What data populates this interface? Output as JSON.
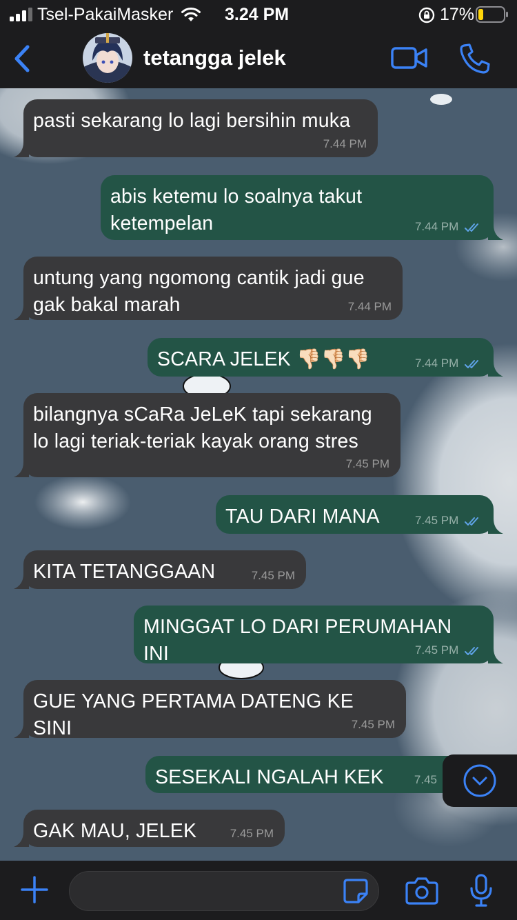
{
  "status_bar": {
    "carrier": "Tsel-PakaiMasker",
    "time": "3.24 PM",
    "battery": "17%",
    "icons": [
      "signal-icon",
      "wifi-icon",
      "orientation-lock-icon",
      "battery-low-icon"
    ]
  },
  "header": {
    "contact_name": "tetangga jelek",
    "icons": [
      "back-chevron-icon",
      "avatar",
      "video-call-icon",
      "phone-call-icon"
    ]
  },
  "messages": [
    {
      "dir": "in",
      "text": "pasti sekarang lo lagi bersihin muka",
      "time": "7.44 PM"
    },
    {
      "dir": "out",
      "text": "abis ketemu lo soalnya takut\nketempelan",
      "time": "7.44 PM",
      "read": true
    },
    {
      "dir": "in",
      "text": "untung yang ngomong cantik jadi gue\ngak bakal marah",
      "time": "7.44 PM"
    },
    {
      "dir": "out",
      "text": "SCARA JELEK 👎🏻👎🏻👎🏻",
      "time": "7.44 PM",
      "read": true
    },
    {
      "dir": "in",
      "text": "bilangnya sCaRa JeLeK tapi sekarang\nlo lagi teriak-teriak kayak orang stres",
      "time": "7.45 PM"
    },
    {
      "dir": "out",
      "text": "TAU DARI MANA",
      "time": "7.45 PM",
      "read": true
    },
    {
      "dir": "in",
      "text": "KITA TETANGGAAN",
      "time": "7.45 PM"
    },
    {
      "dir": "out",
      "text": "MINGGAT LO DARI PERUMAHAN INI",
      "time": "7.45 PM",
      "read": true
    },
    {
      "dir": "in",
      "text": "GUE YANG PERTAMA DATENG KE SINI",
      "time": "7.45 PM"
    },
    {
      "dir": "out",
      "text": "SESEKALI NGALAH KEK",
      "time": "7.45",
      "read": false
    },
    {
      "dir": "in",
      "text": "GAK MAU, JELEK",
      "time": "7.45 PM"
    }
  ],
  "composer": {
    "placeholder": "",
    "icons": [
      "plus-icon",
      "sticker-icon",
      "camera-icon",
      "microphone-icon"
    ]
  },
  "colors": {
    "accent": "#3b82f6",
    "incoming_bubble": "#39393b",
    "outgoing_bubble": "#235446",
    "read_ticks": "#5fa3e8",
    "bars": "#1c1c1e"
  }
}
